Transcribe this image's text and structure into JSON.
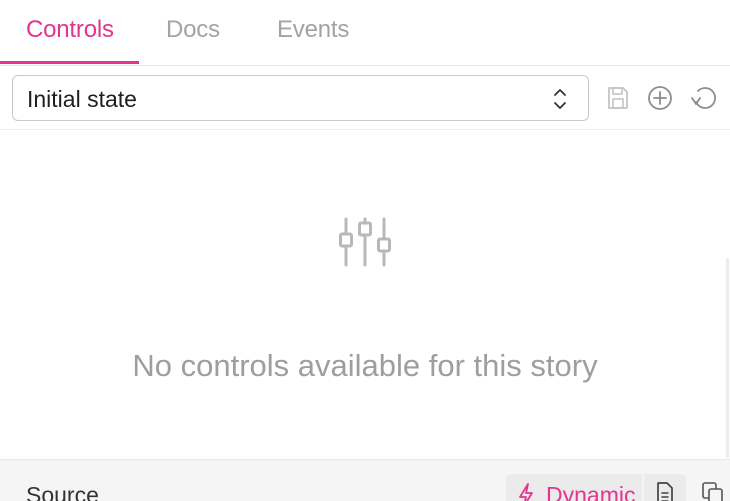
{
  "tabs": [
    {
      "label": "Controls",
      "active": true
    },
    {
      "label": "Docs",
      "active": false
    },
    {
      "label": "Events",
      "active": false
    }
  ],
  "toolbar": {
    "selected_state": "Initial state",
    "icons": [
      "chevrons-up-down-icon",
      "save-icon",
      "add-icon",
      "reset-icon"
    ]
  },
  "empty_state": {
    "icon": "sliders-icon",
    "message": "No controls available for this story"
  },
  "source_bar": {
    "label": "Source",
    "mode_label": "Dynamic",
    "icons": [
      "lightning-icon",
      "document-icon",
      "copy-icon"
    ]
  },
  "colors": {
    "accent": "#e3348f",
    "muted_text": "#a3a3a3",
    "icon_gray": "#9a9a9a",
    "bar_background": "#f5f5f5"
  }
}
